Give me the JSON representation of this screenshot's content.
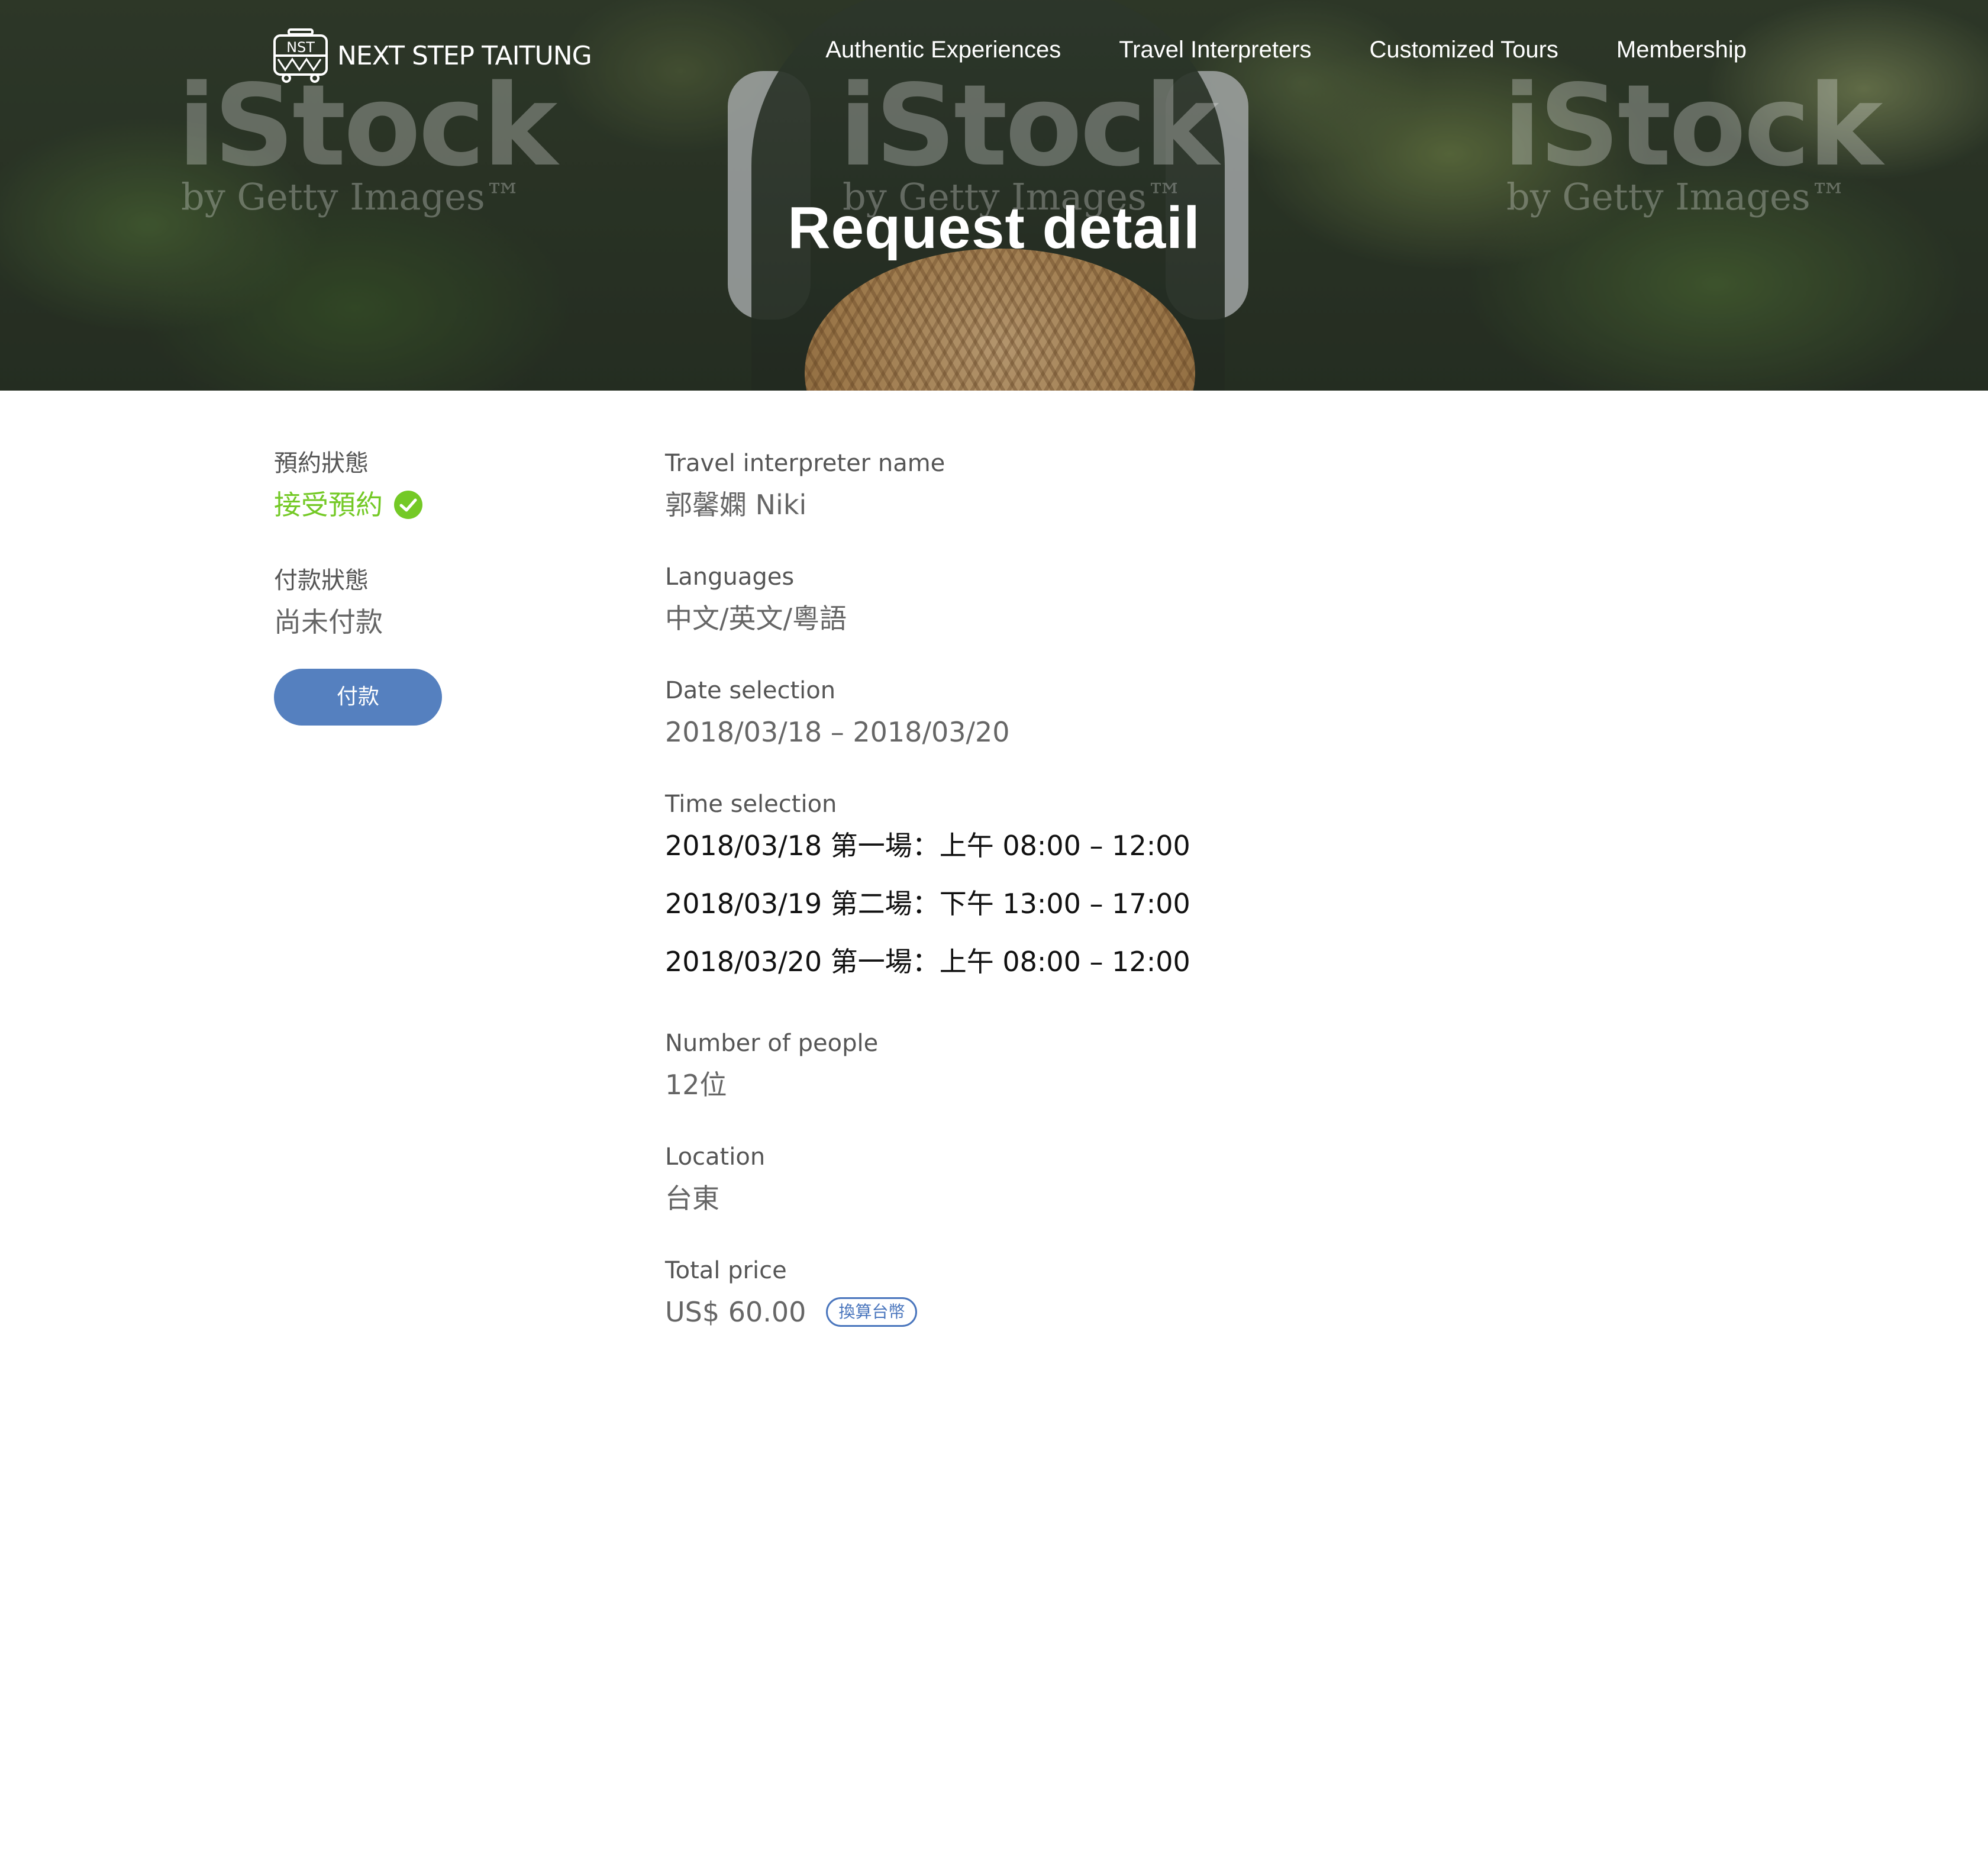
{
  "brand": {
    "logo_text": "NEXT STEP TAITUNG",
    "logo_badge": "NST"
  },
  "nav": {
    "items": [
      {
        "label": "Authentic Experiences"
      },
      {
        "label": "Travel Interpreters"
      },
      {
        "label": "Customized Tours"
      },
      {
        "label": "Membership"
      }
    ]
  },
  "hero": {
    "title": "Request detail",
    "watermark_main": "iStock",
    "watermark_sub": "by Getty Images™"
  },
  "status": {
    "booking_label": "預約狀態",
    "booking_value": "接受預約",
    "booking_icon": "check-circle-icon",
    "payment_label": "付款狀態",
    "payment_value": "尚未付款",
    "pay_button": "付款"
  },
  "details": {
    "interpreter_label": "Travel interpreter name",
    "interpreter_value": "郭馨嫻 Niki",
    "languages_label": "Languages",
    "languages_value": "中文/英文/粵語",
    "date_label": "Date selection",
    "date_value": "2018/03/18 – 2018/03/20",
    "time_label": "Time selection",
    "time_slots": [
      "2018/03/18 第一場：上午 08:00 – 12:00",
      "2018/03/19 第二場：下午 13:00 – 17:00",
      "2018/03/20 第一場：上午 08:00 – 12:00"
    ],
    "people_label": "Number of people",
    "people_value": "12位",
    "location_label": "Location",
    "location_value": "台東",
    "price_label": "Total price",
    "price_value": "US$ 60.00",
    "convert_label": "換算台幣"
  },
  "colors": {
    "accent_green": "#74c926",
    "button_blue": "#5580bf",
    "badge_blue": "#4a76bd"
  }
}
